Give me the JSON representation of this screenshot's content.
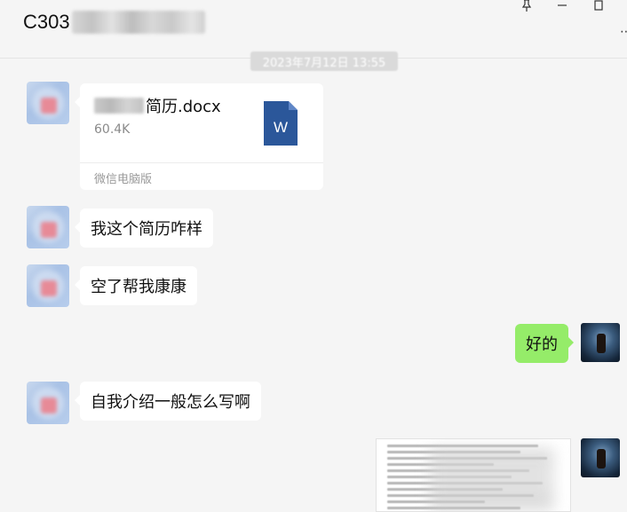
{
  "chat": {
    "title_prefix": "C303",
    "timestamp": "2023年7月12日 13:55"
  },
  "window": {
    "pin_icon": "pin-icon",
    "minimize_icon": "minimize-icon",
    "maximize_icon": "maximize-icon",
    "more_icon": "more-icon"
  },
  "messages": {
    "file": {
      "name_suffix": "简历.docx",
      "size": "60.4K",
      "source": "微信电脑版",
      "icon": "word-doc-icon",
      "icon_letter": "W",
      "icon_color": "#2b579a"
    },
    "msg1": "我这个简历咋样",
    "msg2": "空了帮我康康",
    "msg3": "好的",
    "msg4": "自我介绍一般怎么写啊"
  },
  "colors": {
    "background": "#f5f5f5",
    "bubble_incoming": "#ffffff",
    "bubble_outgoing": "#95ec69"
  }
}
